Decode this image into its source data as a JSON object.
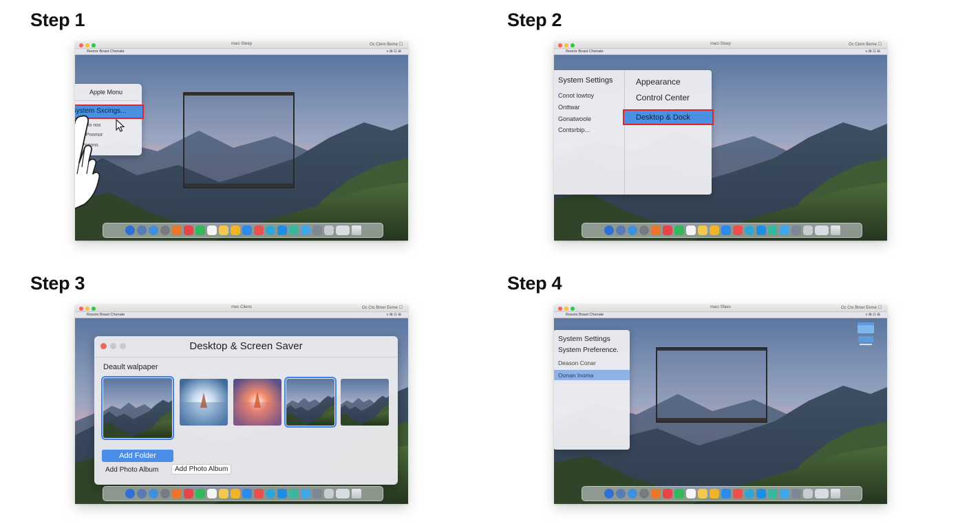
{
  "steps": [
    {
      "title": "Step 1",
      "window_title": "maci Steep",
      "status_text": "Oc Ctem Beme ☐",
      "menubar_items": "Reoror  Bnast  Chenate",
      "menubar_status": "≡ ⊠ ⊡ ⊞",
      "apple_menu": {
        "header": "Apple Monu",
        "items": [
          "System Sxcings...",
          "S  Ifo  nos",
          "5  Pnnmor",
          "Ponnns"
        ]
      }
    },
    {
      "title": "Step 2",
      "window_title": "maci Stsep",
      "status_text": "Oc Ctem Beme ☐",
      "menubar_items": "Reoror  Bnast  Chenate",
      "menubar_status": "≡ ⊠ ⊡ ⊞",
      "settings_panel": {
        "left_header": "System Settings",
        "left_items": [
          "Conot lowtoy",
          "Onttwar",
          "Gonatwoole",
          "Contsrbip..."
        ],
        "right_items": [
          "Appearance",
          "Control Center",
          "Desktop & Dock"
        ]
      }
    },
    {
      "title": "Step 3",
      "window_title": "mec Cliens",
      "status_text": "Oc Cto Bmer Eeme ☐",
      "menubar_items": "Rosom  Bnast  Chenate",
      "menubar_status": "≡ ⊠ ⊡ ⊞",
      "dialog": {
        "title": "Desktop & Screen Saver",
        "section_label": "Deault walpaper",
        "add_folder": "Add Folder",
        "add_photo_album_1": "Add Photo Album",
        "add_photo_album_2": "Add Photo Album"
      }
    },
    {
      "title": "Step 4",
      "window_title": "maci Sfaes",
      "status_text": "Oc Cto Bmer Eeme ☐",
      "menubar_items": "Rosom  Bnast  Chenate",
      "menubar_status": "≡ ⊠ ⊡ ⊞",
      "menu": {
        "items": [
          "System Settings",
          "System Preference.",
          "Deason Conar",
          "Oonan Inoma"
        ]
      }
    }
  ],
  "colors": {
    "highlight_blue": "#4a90e2",
    "highlight_border": "#e0252b",
    "selection_blue": "#3b82f6"
  },
  "icons": [
    "apple-icon",
    "pointer-cursor-icon",
    "hand-cursor-icon",
    "dock-app-icon",
    "trash-icon",
    "desktop-folder-icon"
  ]
}
